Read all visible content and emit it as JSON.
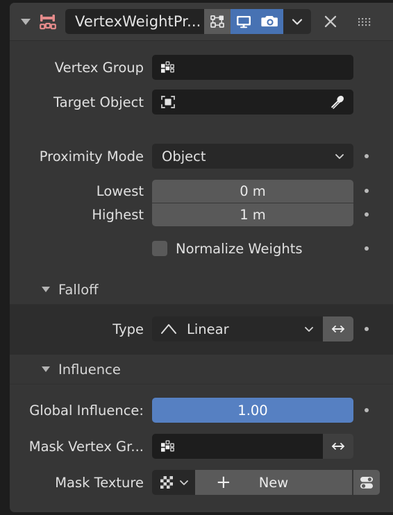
{
  "colors": {
    "panel_bg": "#363636",
    "subpanel_bg": "#2d2d2d",
    "header_bg": "#3b3b3b",
    "field_dark": "#1d1d1d",
    "field_gray": "#595959",
    "accent_blue": "#4772b3",
    "slider_blue": "#5680c2",
    "modifier_icon": "#e58b8b",
    "text": "#e0e0e0"
  },
  "header": {
    "expand_icon": "triangle-down-icon",
    "modifier_icon": "vertex-weight-proximity-icon",
    "name_value": "VertexWeightPr...",
    "toggles": [
      {
        "name": "edit-mode-display-toggle",
        "icon": "edit-mode-icon",
        "active": false
      },
      {
        "name": "realtime-display-toggle",
        "icon": "display-monitor-icon",
        "active": true
      },
      {
        "name": "render-display-toggle",
        "icon": "camera-icon",
        "active": true
      }
    ],
    "dropdown_icon": "chevron-down-icon",
    "close_icon": "close-x-icon",
    "grip_icon": "drag-handle-icon"
  },
  "fields": {
    "vertex_group": {
      "label": "Vertex Group",
      "icon": "vertex-group-icon",
      "value": ""
    },
    "target_object": {
      "label": "Target Object",
      "icon": "object-icon",
      "value": "",
      "eyedropper_icon": "eyedropper-icon"
    },
    "proximity_mode": {
      "label": "Proximity Mode",
      "value": "Object",
      "chevron_icon": "chevron-down-icon"
    },
    "lowest": {
      "label": "Lowest",
      "value": "0 m"
    },
    "highest": {
      "label": "Highest",
      "value": "1 m"
    },
    "normalize_weights": {
      "label": "Normalize Weights",
      "checked": false
    }
  },
  "falloff": {
    "title": "Falloff",
    "expanded": true,
    "type": {
      "label": "Type",
      "value": "Linear",
      "curve_icon": "linear-curve-icon",
      "chevron_icon": "chevron-down-icon",
      "invert_icon": "left-right-arrows-icon"
    }
  },
  "influence": {
    "title": "Influence",
    "expanded": true,
    "global_influence": {
      "label": "Global Influence:",
      "value": "1.00"
    },
    "mask_vertex_group": {
      "label": "Mask Vertex Gr...",
      "icon": "vertex-group-icon",
      "value": "",
      "invert_icon": "left-right-arrows-icon"
    },
    "mask_texture": {
      "label": "Mask Texture",
      "browse_icon": "texture-checker-icon",
      "browse_chevron_icon": "chevron-down-icon",
      "add_icon": "plus-icon",
      "new_label": "New",
      "settings_icon": "texture-settings-icon"
    }
  }
}
